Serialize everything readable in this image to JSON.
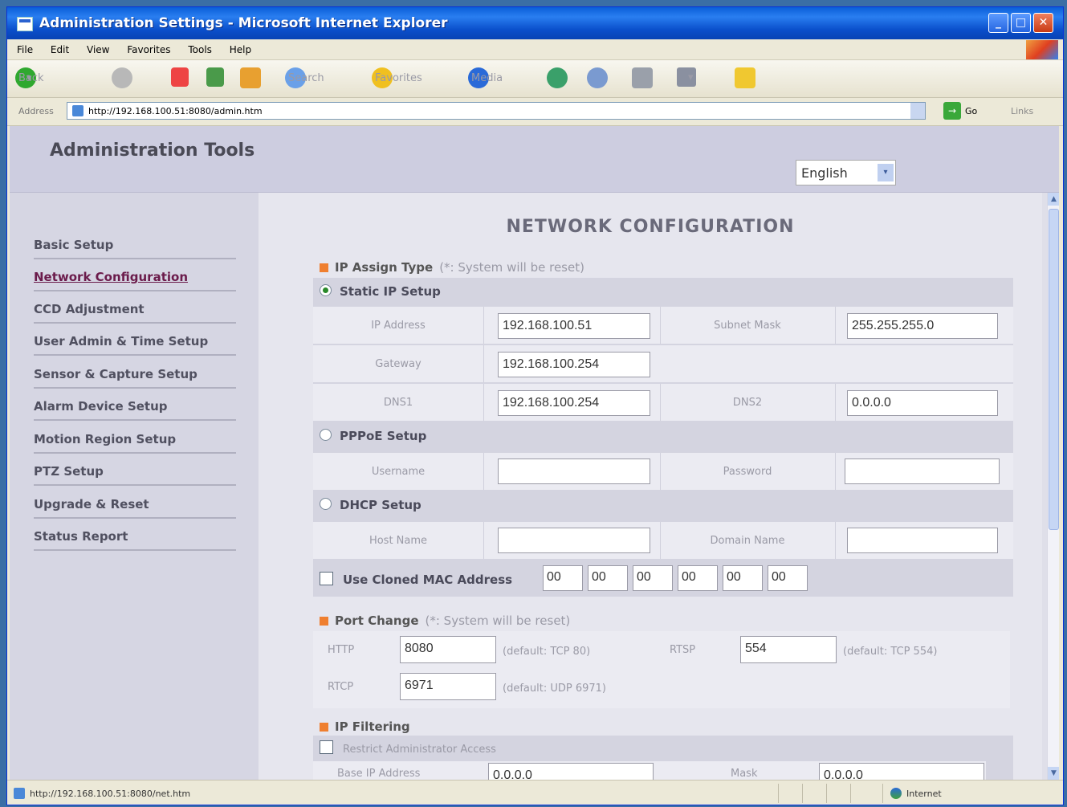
{
  "window": {
    "title": "Administration Settings - Microsoft Internet Explorer",
    "min_glyph": "_",
    "max_glyph": "□",
    "close_glyph": "✕"
  },
  "menu": [
    "File",
    "Edit",
    "View",
    "Favorites",
    "Tools",
    "Help"
  ],
  "toolbar": {
    "back": "Back",
    "search": "Search",
    "favorites": "Favorites",
    "media": "Media",
    "dropdown_glyph": "▾"
  },
  "address": {
    "label": "Address",
    "url": "http://192.168.100.51:8080/admin.htm",
    "go": "Go",
    "links": "Links",
    "go_glyph": "→"
  },
  "header": {
    "title": "Administration Tools",
    "language": "English",
    "dropdown_glyph": "▾"
  },
  "sidebar": {
    "items": [
      {
        "label": "Basic Setup"
      },
      {
        "label": "Network Configuration"
      },
      {
        "label": "CCD Adjustment"
      },
      {
        "label": "User Admin & Time Setup"
      },
      {
        "label": "Sensor & Capture Setup"
      },
      {
        "label": "Alarm Device Setup"
      },
      {
        "label": "Motion Region Setup"
      },
      {
        "label": "PTZ Setup"
      },
      {
        "label": "Upgrade & Reset"
      },
      {
        "label": "Status Report"
      }
    ]
  },
  "main": {
    "title": "NETWORK CONFIGURATION",
    "ip_assign": {
      "label": "IP Assign Type",
      "note": "(*: System will be reset)",
      "static_label": "Static IP Setup",
      "ip_label": "IP Address",
      "ip_value": "192.168.100.51",
      "mask_label": "Subnet Mask",
      "mask_value": "255.255.255.0",
      "gateway_label": "Gateway",
      "gateway_value": "192.168.100.254",
      "dns1_label": "DNS1",
      "dns1_value": "192.168.100.254",
      "dns2_label": "DNS2",
      "dns2_value": "0.0.0.0",
      "pppoe_label": "PPPoE Setup",
      "username_label": "Username",
      "username_value": "",
      "password_label": "Password",
      "password_value": "",
      "dhcp_label": "DHCP Setup",
      "host_label": "Host Name",
      "host_value": "",
      "domain_label": "Domain Name",
      "domain_value": "",
      "mac_label": "Use Cloned MAC Address",
      "mac_values": [
        "00",
        "00",
        "00",
        "00",
        "00",
        "00"
      ]
    },
    "port_change": {
      "label": "Port Change",
      "note": "(*: System will be reset)",
      "http_label": "HTTP",
      "http_value": "8080",
      "http_hint": "(default: TCP 80)",
      "rtsp_label": "RTSP",
      "rtsp_value": "554",
      "rtsp_hint": "(default: TCP 554)",
      "rtcp_label": "RTCP",
      "rtcp_value": "6971",
      "rtcp_hint": "(default: UDP 6971)"
    },
    "ip_filtering": {
      "label": "IP Filtering",
      "restrict_label": "Restrict Administrator Access",
      "base_label": "Base IP Address",
      "base_value": "0.0.0.0",
      "mask_label": "Mask",
      "mask_value": "0.0.0.0"
    }
  },
  "scrollbar": {
    "up_glyph": "▲",
    "down_glyph": "▼"
  },
  "status": {
    "url": "http://192.168.100.51:8080/net.htm",
    "zone": "Internet"
  }
}
